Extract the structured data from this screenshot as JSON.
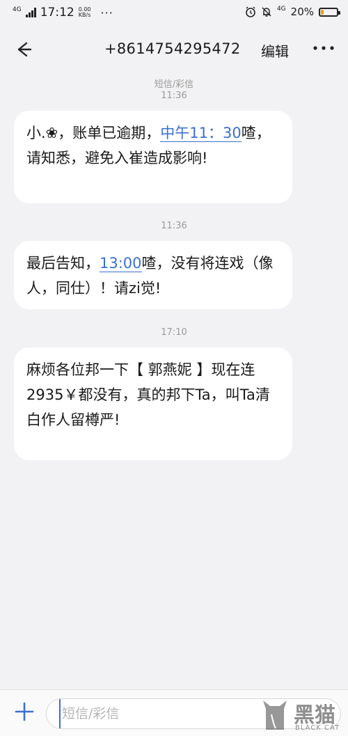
{
  "status_bar": {
    "network": "4G",
    "time": "17:12",
    "speed_value": "0.00",
    "speed_unit": "KB/s",
    "more": "···",
    "network_right": "4G",
    "battery_percent": "20%",
    "battery_level": 0.2,
    "icons": [
      "signal-icon",
      "alarm-clock-icon",
      "mute-bell-icon",
      "battery-icon"
    ]
  },
  "header": {
    "back_icon": "back-arrow-icon",
    "title": "+8614754295472",
    "edit_label": "编辑",
    "more_icon": "more-icon"
  },
  "thread": {
    "channel": "短信/彩信",
    "messages": [
      {
        "timestamp": "11:36",
        "text_before": "小.❀，账单已逾期，",
        "link": "中午11：30",
        "text_after": "喳，请知悉，避免入崔造成影响!"
      },
      {
        "timestamp": "11:36",
        "text_before": "最后告知，",
        "link": "13:00",
        "text_after": "喳，没有将连戏（像人，同仕）！请zi觉!"
      },
      {
        "timestamp": "17:10",
        "text": "麻烦各位邦一下【 郭燕妮 】现在连 2935￥都没有，真的邦下Ta，叫Ta清白作人留樽严!"
      }
    ]
  },
  "compose": {
    "add_icon": "plus-icon",
    "placeholder": "短信/彩信"
  },
  "watermark": {
    "cn": "黑猫",
    "en": "BLACK CAT"
  },
  "colors": {
    "accent": "#3b6fd0",
    "battery": "#f0a000",
    "background": "#f2f2f4",
    "bubble": "#ffffff"
  }
}
